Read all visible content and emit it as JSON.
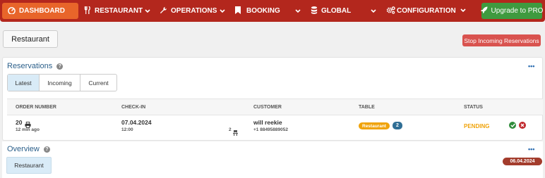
{
  "nav": {
    "dashboard": "DASHBOARD",
    "restaurant": "RESTAURANT",
    "operations": "OPERATIONS",
    "booking": "BOOKING",
    "global": "GLOBAL",
    "configuration": "CONFIGURATION",
    "upgrade": "Upgrade to PRO"
  },
  "header": {
    "page_title": "Restaurant",
    "stop_button": "Stop Incoming Reservations"
  },
  "reservations": {
    "title": "Reservations",
    "more": "•••",
    "tabs": [
      "Latest",
      "Incoming",
      "Current"
    ],
    "columns": [
      "ORDER NUMBER",
      "CHECK-IN",
      "CUSTOMER",
      "TABLE",
      "STATUS"
    ],
    "row": {
      "order_number": "20",
      "order_age": "12 min ago",
      "checkin_date": "07.04.2024",
      "checkin_time": "12:00",
      "guests": "2",
      "customer_name": "will reekie",
      "customer_phone": "+1 88495889052",
      "table_room": "Restaurant",
      "table_number": "2",
      "status": "PENDING"
    }
  },
  "overview": {
    "title": "Overview",
    "more": "•••",
    "tab": "Restaurant",
    "date": "06.04.2024"
  },
  "colors": {
    "nav_bg": "#b3271d",
    "nav_active": "#e8652a",
    "upgrade_bg": "#3f9a3f",
    "stop_bg": "#d9534f",
    "pending": "#f0a30a",
    "link_blue": "#2b5f8a"
  }
}
